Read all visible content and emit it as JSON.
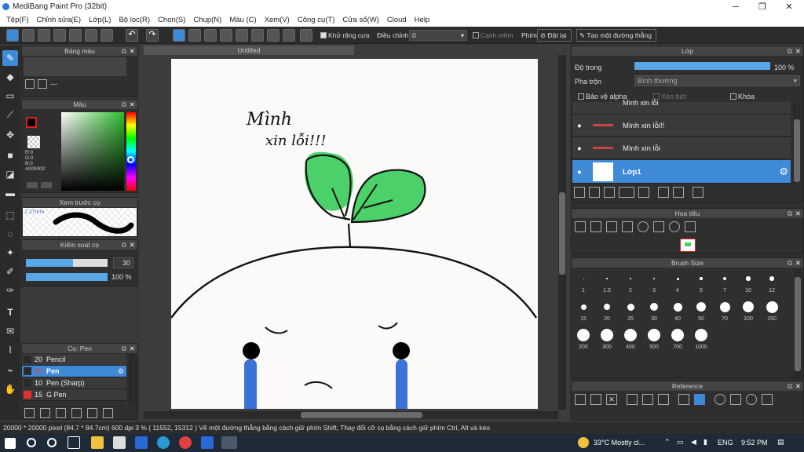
{
  "window": {
    "title": "MediBang Paint Pro (32bit)",
    "minimize": "─",
    "maximize": "❐",
    "close": "✕"
  },
  "menu": [
    "Tệp(F)",
    "Chỉnh sửa(E)",
    "Lớp(L)",
    "Bộ lọc(R)",
    "Chọn(S)",
    "Chụp(N)",
    "Màu (C)",
    "Xem(V)",
    "Công cụ(T)",
    "Cửa sổ(W)",
    "Cloud",
    "Help"
  ],
  "toolbar": {
    "antialias_label": "Khử răng cưa",
    "adjust_label": "Điều chỉnh",
    "adjust_value": "0",
    "edge_label": "Cạnh mềm",
    "key_label": "Phím",
    "reset_label": "Đặt lại",
    "line_label": "Tạo một đường thẳng"
  },
  "panels": {
    "palette": {
      "title": "Bảng màu",
      "value": "---"
    },
    "color": {
      "title": "Màu",
      "r": "R:0",
      "g": "G:0",
      "b": "B:0",
      "a": "A:0",
      "hex": "#000000"
    },
    "brush_preview": {
      "title": "Xem trước cọ",
      "size": "1.27mm"
    },
    "brush_control": {
      "title": "Kiểm soát cọ",
      "size_value": "30",
      "opacity_value": "100 %",
      "size_fraction": 0.58,
      "opacity_fraction": 1.0
    },
    "brush_list": {
      "title": "Cọ: Pen",
      "items": [
        {
          "size": "20",
          "name": "Pencil",
          "color": "#2a2a2a",
          "selected": false
        },
        {
          "size": "30",
          "name": "Pen",
          "color": "#2a2a2a",
          "selected": true
        },
        {
          "size": "10",
          "name": "Pen (Sharp)",
          "color": "#2a2a2a",
          "selected": false
        },
        {
          "size": "15",
          "name": "G Pen",
          "color": "#e53030",
          "selected": false
        }
      ]
    },
    "layer": {
      "title": "Lớp",
      "opacity_label": "Độ trong",
      "opacity_value": "100 %",
      "blend_label": "Pha trộn",
      "blend_value": "Bình thường",
      "protect_alpha": "Bảo vệ alpha",
      "clip": "Xén bớt",
      "lock": "Khóa",
      "layers": [
        {
          "name": "Mình xin lỗi",
          "selected": false
        },
        {
          "name": "Mình xin lỗi!!",
          "selected": false
        },
        {
          "name": "Mình xin lỗi",
          "selected": false
        },
        {
          "name": "Lớp1",
          "selected": true
        }
      ]
    },
    "navigator": {
      "title": "Hoa tiêu"
    },
    "brush_size": {
      "title": "Brush Size",
      "sizes": [
        "1",
        "1.5",
        "2",
        "3",
        "4",
        "5",
        "7",
        "10",
        "12",
        "15",
        "20",
        "25",
        "30",
        "40",
        "50",
        "70",
        "100",
        "150",
        "200",
        "300",
        "400",
        "500",
        "700",
        "1000"
      ]
    },
    "reference": {
      "title": "Reference"
    }
  },
  "canvas": {
    "tab": "Untitled",
    "text_line1": "Mình",
    "text_line2": "xin lỗi!!!"
  },
  "status": "20000 * 20000 pixel   (84.7 * 84.7cm)   600 dpi   3 %   ( 11552, 15312 )   Vẽ một đường thẳng bằng cách giữ phím Shift, Thay đổi cỡ cọ bằng cách giữ phím Ctrl, Alt và kéo",
  "taskbar": {
    "weather": "33°C  Mostly cl...",
    "lang": "ENG",
    "time": "9:52 PM"
  },
  "colors": {
    "accent": "#3e8ad6",
    "leaf": "#4cd06a",
    "tear": "#3a72d8"
  }
}
